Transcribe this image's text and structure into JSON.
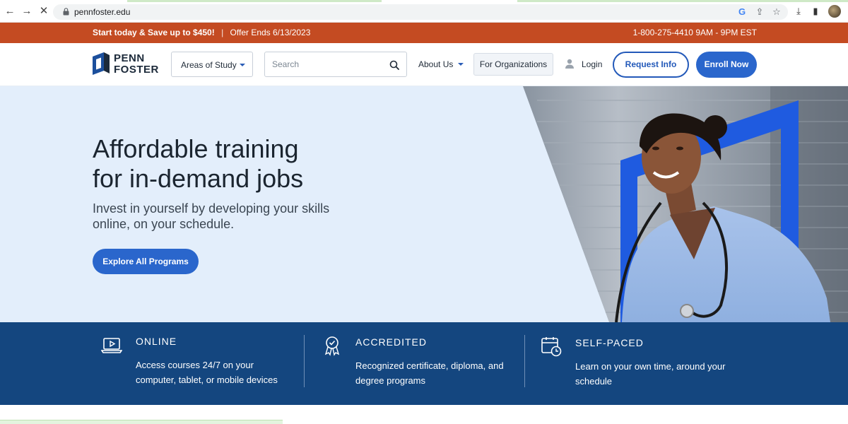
{
  "browser": {
    "url": "pennfoster.edu"
  },
  "promo": {
    "headline": "Start today & Save up to $450!",
    "separator": "|",
    "offer": "Offer Ends 6/13/2023",
    "phone_hours": "1-800-275-4410 9AM - 9PM EST"
  },
  "header": {
    "logo_line1": "PENN",
    "logo_line2": "FOSTER",
    "areas_label": "Areas of Study",
    "search_placeholder": "Search",
    "about_label": "About Us",
    "for_orgs_label": "For Organizations",
    "login_label": "Login",
    "request_info_label": "Request Info",
    "enroll_label": "Enroll Now"
  },
  "hero": {
    "title_line1": "Affordable training",
    "title_line2": "for in-demand jobs",
    "subtitle_line1": "Invest in yourself by developing your skills",
    "subtitle_line2": "online, on your schedule.",
    "cta_label": "Explore All Programs"
  },
  "features": [
    {
      "title": "ONLINE",
      "desc_line1": "Access courses 24/7 on your",
      "desc_line2": "computer, tablet, or mobile devices",
      "icon": "laptop-play-icon"
    },
    {
      "title": "ACCREDITED",
      "desc_line1": "Recognized certificate, diploma, and",
      "desc_line2": "degree programs",
      "icon": "award-ribbon-icon"
    },
    {
      "title": "SELF-PACED",
      "desc_line1": "Learn on your own time, around your",
      "desc_line2": "schedule",
      "icon": "calendar-clock-icon"
    }
  ],
  "colors": {
    "promo_bg": "#c44b22",
    "brand_blue": "#2a66cc",
    "features_bg": "#14467f",
    "hero_bg": "#e3eefb"
  }
}
